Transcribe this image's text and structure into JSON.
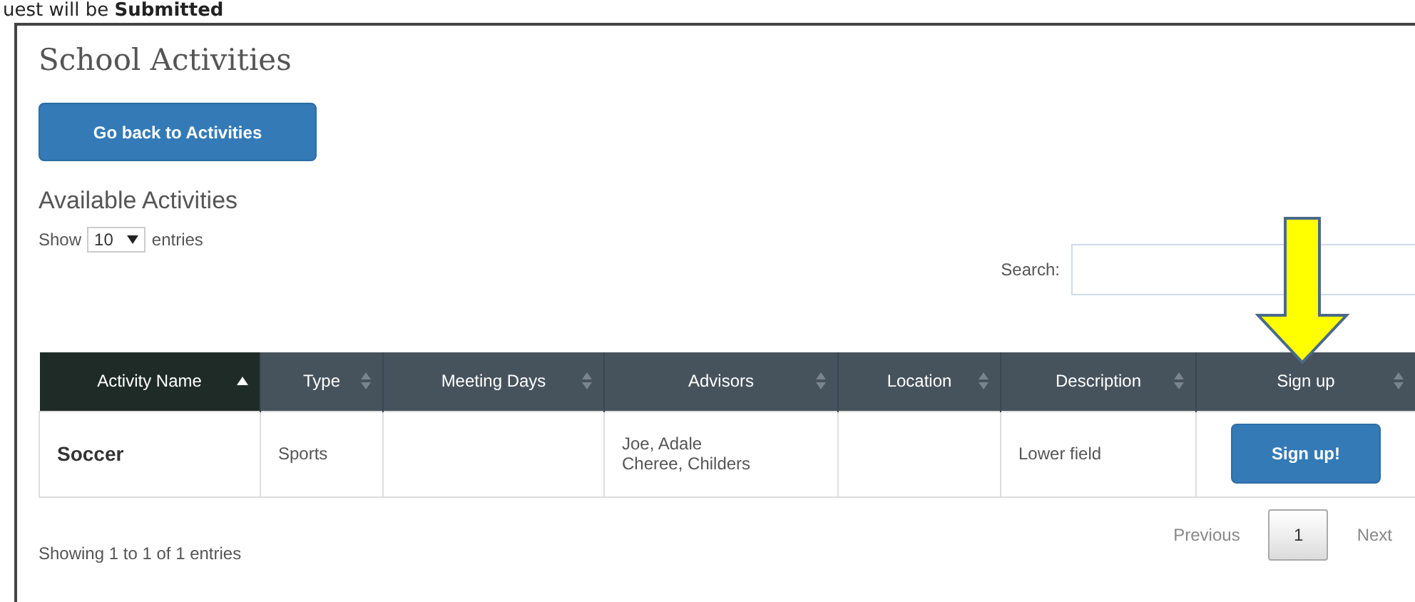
{
  "page_caption": "uest will be **Submitted**",
  "title": "School Activities",
  "back_button": "Go back to Activities",
  "section_heading": "Available Activities",
  "length_control": {
    "label_before": "Show",
    "value": "10",
    "label_after": "entries"
  },
  "search": {
    "label": "Search:"
  },
  "table": {
    "columns": [
      {
        "label": "Activity Name",
        "sorted": true
      },
      {
        "label": "Type",
        "sorted": false
      },
      {
        "label": "Meeting Days",
        "sorted": false
      },
      {
        "label": "Advisors",
        "sorted": false
      },
      {
        "label": "Location",
        "sorted": false
      },
      {
        "label": "Description",
        "sorted": false
      },
      {
        "label": "Sign up",
        "sorted": false
      }
    ],
    "rows": [
      {
        "cells": [
          {
            "kind": "name",
            "text": "Soccer"
          },
          {
            "kind": "text",
            "text": "Sports"
          },
          {
            "kind": "empty"
          },
          {
            "kind": "lines",
            "lines": [
              "Joe, Adale",
              "Cheree, Childers"
            ]
          },
          {
            "kind": "empty"
          },
          {
            "kind": "text",
            "text": "Lower field"
          },
          {
            "kind": "button",
            "text": "Sign up!"
          }
        ]
      }
    ]
  },
  "info": "Showing 1 to 1 of 1 entries",
  "pagination": {
    "previous": {
      "label": "Previous",
      "disabled": true
    },
    "pages": [
      {
        "label": "1",
        "selected": true
      }
    ],
    "next": {
      "label": "Next",
      "disabled": true
    }
  },
  "callout_arrow": {
    "kind": "arrow"
  }
}
